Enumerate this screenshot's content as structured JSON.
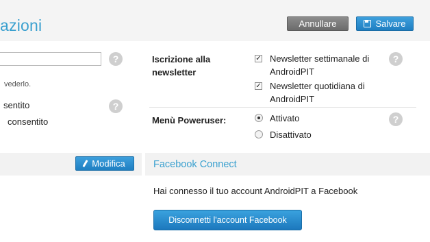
{
  "header": {
    "title": "azioni",
    "cancel_label": "Annullare",
    "save_label": "Salvare"
  },
  "left_panel": {
    "input_value": "",
    "note": "vederlo.",
    "option_1": "sentito",
    "option_2": "consentito",
    "edit_label": "Modifica"
  },
  "newsletter": {
    "label": "Iscrizione alla newsletter",
    "weekly": {
      "label": "Newsletter settimanale di AndroidPIT",
      "checked": true
    },
    "daily": {
      "label": "Newsletter quotidiana di AndroidPIT",
      "checked": true
    }
  },
  "poweruser": {
    "label": "Menù Poweruser:",
    "options": [
      {
        "label": "Attivato",
        "selected": true
      },
      {
        "label": "Disattivato",
        "selected": false
      }
    ]
  },
  "facebook": {
    "title": "Facebook Connect",
    "info": "Hai connesso il tuo account AndroidPIT a Facebook",
    "disconnect_label": "Disconnetti l'account Facebook"
  },
  "help_glyph": "?",
  "colors": {
    "accent": "#3aa0cf",
    "primary_button": "#2a8fd1",
    "secondary_button": "#7a7a7a",
    "help_icon": "#cfcfcf"
  }
}
